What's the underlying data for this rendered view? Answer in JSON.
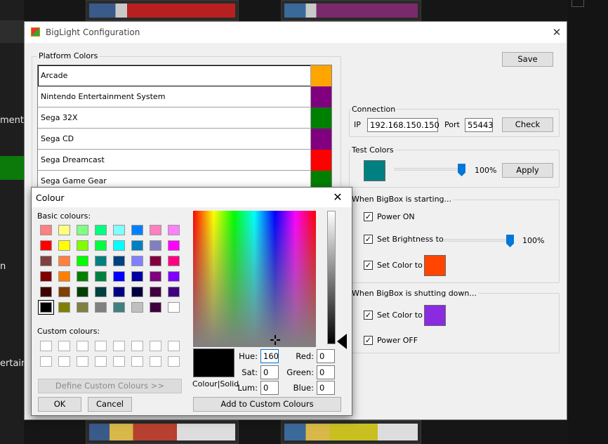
{
  "background": {
    "left_texts": [
      "ment...",
      "n",
      "ertain"
    ]
  },
  "config": {
    "title": "BigLight Configuration",
    "save_label": "Save",
    "platform_colors": {
      "label": "Platform Colors",
      "rows": [
        {
          "name": "Arcade",
          "color": "#ffa500"
        },
        {
          "name": "Nintendo Entertainment System",
          "color": "#800080"
        },
        {
          "name": "Sega 32X",
          "color": "#008000"
        },
        {
          "name": "Sega CD",
          "color": "#800080"
        },
        {
          "name": "Sega Dreamcast",
          "color": "#ff0000"
        },
        {
          "name": "Sega Game Gear",
          "color": "#008000"
        }
      ]
    },
    "connection": {
      "label": "Connection",
      "ip_label": "IP",
      "ip_value": "192.168.150.150",
      "port_label": "Port",
      "port_value": "55443",
      "check_label": "Check"
    },
    "test_colors": {
      "label": "Test Colors",
      "swatch": "#008080",
      "brightness": 100,
      "brightness_text": "100%",
      "apply_label": "Apply"
    },
    "starting": {
      "label": "When BigBox is starting...",
      "power_on": "Power ON",
      "set_brightness": "Set Brightness to",
      "brightness": 100,
      "brightness_text": "100%",
      "set_color": "Set Color to",
      "color": "#ff4500"
    },
    "shutting": {
      "label": "When BigBox is shutting down...",
      "set_color": "Set Color to",
      "color": "#8a2be2",
      "power_off": "Power OFF"
    }
  },
  "colour_dialog": {
    "title": "Colour",
    "basic_label": "Basic colours:",
    "custom_label": "Custom colours:",
    "define_label": "Define Custom Colours >>",
    "ok_label": "OK",
    "cancel_label": "Cancel",
    "add_label": "Add to Custom Colours",
    "colour_solid": "Colour|Solid",
    "hue_label": "Hue:",
    "hue": "160",
    "sat_label": "Sat:",
    "sat": "0",
    "lum_label": "Lum:",
    "lum": "0",
    "red_label": "Red:",
    "red": "0",
    "green_label": "Green:",
    "green": "0",
    "blue_label": "Blue:",
    "blue": "0",
    "basic_colors": [
      "#ff8080",
      "#ffff80",
      "#80ff80",
      "#00ff80",
      "#80ffff",
      "#0080ff",
      "#ff80c0",
      "#ff80ff",
      "#ff0000",
      "#ffff00",
      "#80ff00",
      "#00ff40",
      "#00ffff",
      "#0080c0",
      "#8080c0",
      "#ff00ff",
      "#804040",
      "#ff8040",
      "#00ff00",
      "#008080",
      "#004080",
      "#8080ff",
      "#800040",
      "#ff0080",
      "#800000",
      "#ff8000",
      "#008000",
      "#008040",
      "#0000ff",
      "#0000a0",
      "#800080",
      "#8000ff",
      "#400000",
      "#804000",
      "#004000",
      "#004040",
      "#000080",
      "#000040",
      "#400040",
      "#400080",
      "#000000",
      "#808000",
      "#808040",
      "#808080",
      "#408080",
      "#c0c0c0",
      "#400040",
      "#ffffff"
    ]
  }
}
